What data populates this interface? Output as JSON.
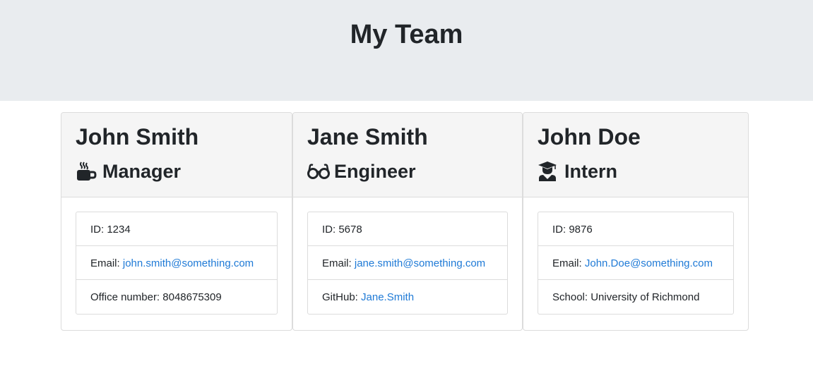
{
  "header": {
    "title": "My Team"
  },
  "team": [
    {
      "name": "John Smith",
      "role": "Manager",
      "icon": "mug-icon",
      "id_label": "ID:",
      "id": "1234",
      "email_label": "Email:",
      "email": "john.smith@something.com",
      "extra_label": "Office number:",
      "extra_value": "8048675309"
    },
    {
      "name": "Jane Smith",
      "role": "Engineer",
      "icon": "glasses-icon",
      "id_label": "ID:",
      "id": "5678",
      "email_label": "Email:",
      "email": "jane.smith@something.com",
      "extra_label": "GitHub:",
      "extra_value": "Jane.Smith"
    },
    {
      "name": "John Doe",
      "role": "Intern",
      "icon": "graduate-icon",
      "id_label": "ID:",
      "id": "9876",
      "email_label": "Email:",
      "email": "John.Doe@something.com",
      "extra_label": "School:",
      "extra_value": "University of Richmond"
    }
  ],
  "colors": {
    "header_bg": "#e9ecef",
    "card_header_bg": "#f5f5f5",
    "link": "#1f7ad6",
    "text": "#212529",
    "border": "#dcdcdc"
  }
}
